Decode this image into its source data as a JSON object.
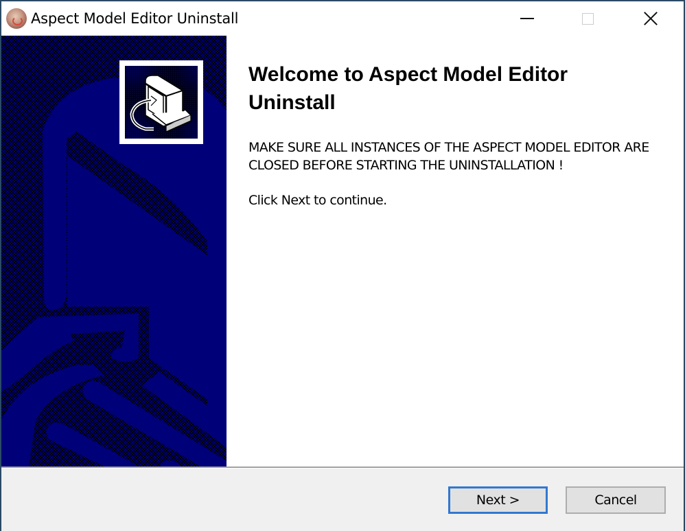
{
  "window": {
    "title": "Aspect Model Editor Uninstall",
    "app_icon": "app-logo-icon",
    "controls": {
      "minimize": "minimize-icon",
      "maximize": "maximize-icon",
      "close": "close-icon"
    }
  },
  "side_panel": {
    "image": "wizard-arrow-graphic",
    "badge_icon": "uninstaller-computer-icon"
  },
  "content": {
    "title": "Welcome to Aspect Model Editor Uninstall",
    "warning": "MAKE SURE ALL INSTANCES OF THE ASPECT MODEL EDITOR ARE CLOSED BEFORE STARTING THE UNINSTALLATION !",
    "instruction": "Click Next to continue."
  },
  "footer": {
    "next_label": "Next >",
    "cancel_label": "Cancel"
  },
  "colors": {
    "panel_blue": "#000080",
    "focus_blue": "#3178d0",
    "footer_bg": "#f0f0f0"
  }
}
